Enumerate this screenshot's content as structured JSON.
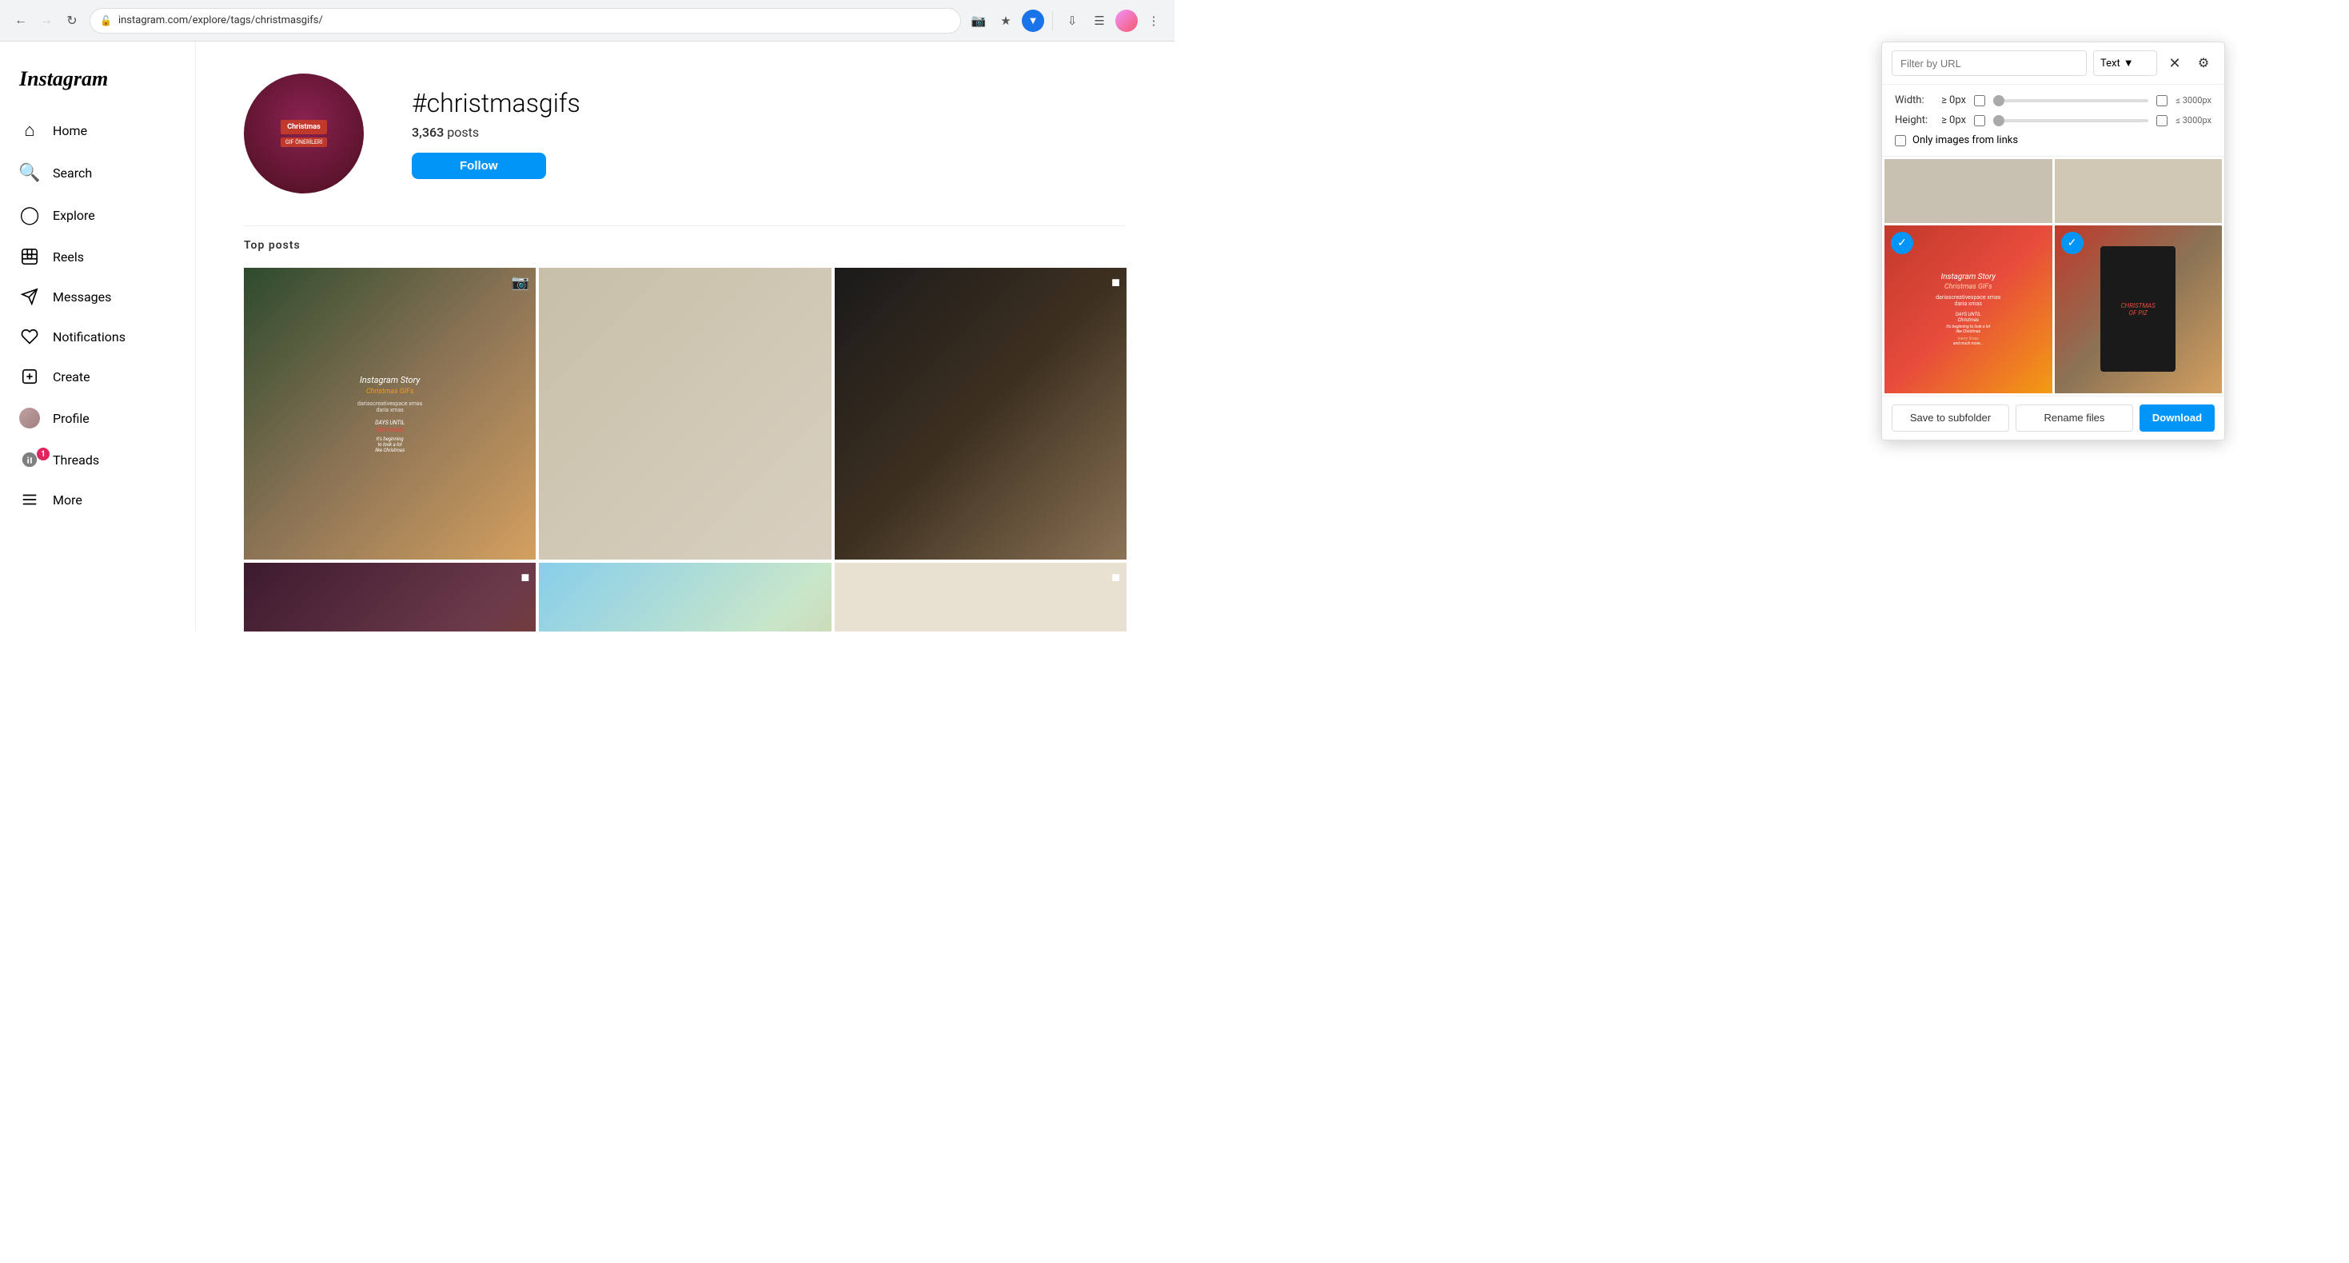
{
  "browser": {
    "url": "instagram.com/explore/tags/christmasgifs/",
    "back_disabled": false,
    "forward_disabled": false
  },
  "sidebar": {
    "logo": "Instagram",
    "items": [
      {
        "id": "home",
        "label": "Home",
        "icon": "⌂"
      },
      {
        "id": "search",
        "label": "Search",
        "icon": "🔍"
      },
      {
        "id": "explore",
        "label": "Explore",
        "icon": "◎"
      },
      {
        "id": "reels",
        "label": "Reels",
        "icon": "▶"
      },
      {
        "id": "messages",
        "label": "Messages",
        "icon": "✈"
      },
      {
        "id": "notifications",
        "label": "Notifications",
        "icon": "♡"
      },
      {
        "id": "create",
        "label": "Create",
        "icon": "⊕"
      },
      {
        "id": "profile",
        "label": "Profile",
        "icon": "avatar"
      },
      {
        "id": "threads",
        "label": "Threads",
        "icon": "◎",
        "badge": "1"
      },
      {
        "id": "more",
        "label": "More",
        "icon": "☰"
      }
    ]
  },
  "page": {
    "hashtag": "#christmasgifs",
    "posts_count": "3,363",
    "posts_label": "posts",
    "section_title": "Top posts",
    "follow_button": "Follow"
  },
  "extension_popup": {
    "filter_placeholder": "Filter by URL",
    "text_dropdown_label": "Text",
    "width_label": "Width:",
    "width_min": "≥ 0px",
    "width_max": "≤ 3000px",
    "height_label": "Height:",
    "height_min": "≥ 0px",
    "height_max": "≤ 3000px",
    "only_images_label": "Only images from links",
    "save_subfolder_label": "Save to subfolder",
    "rename_files_label": "Rename files",
    "download_label": "Download"
  }
}
